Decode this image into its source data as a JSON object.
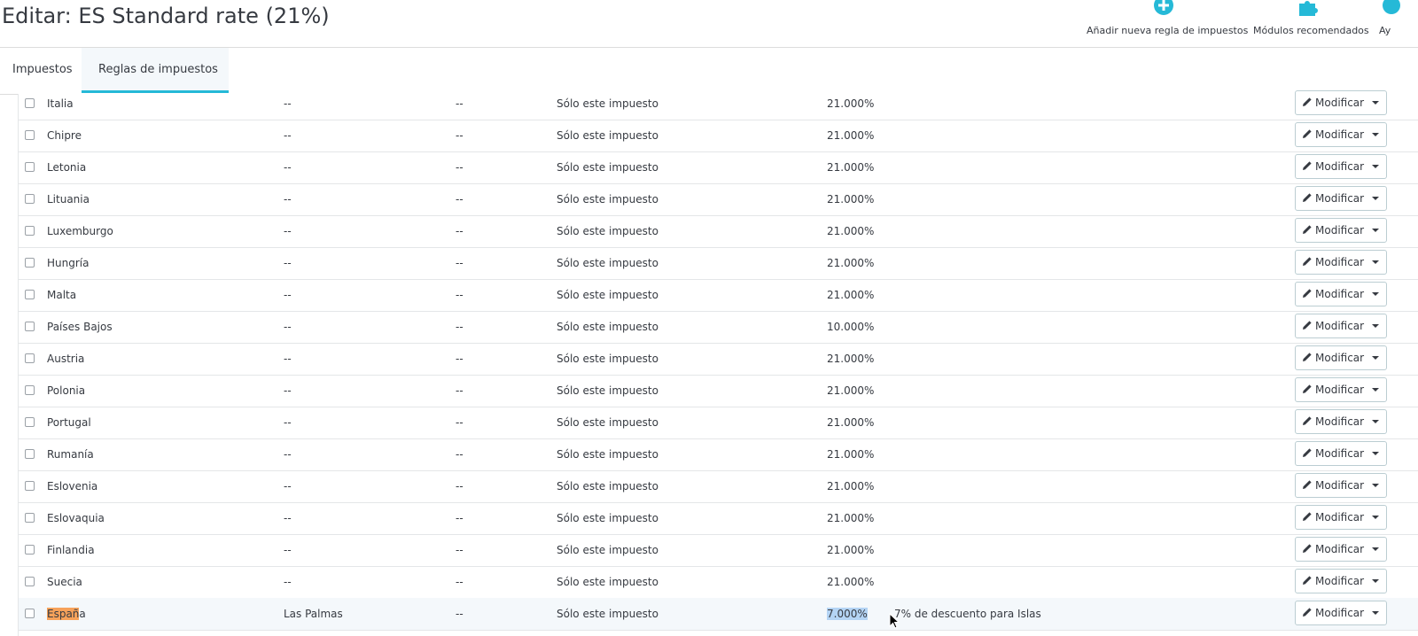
{
  "header": {
    "title": "Editar: ES Standard rate (21%)",
    "buttons": [
      {
        "label": "Añadir nueva regla de impuestos",
        "icon": "plus-circle-icon"
      },
      {
        "label": "Módulos recomendados",
        "icon": "puzzle-icon"
      },
      {
        "label": "Ay",
        "icon": "help-icon"
      }
    ]
  },
  "tabs": [
    {
      "label": "Impuestos",
      "active": false
    },
    {
      "label": "Reglas de impuestos",
      "active": true
    }
  ],
  "colors": {
    "accent": "#25b9d7",
    "highlight_row": "#f4f8fb",
    "search_match": "#f7a25a",
    "text_selection": "#b4d4f4"
  },
  "rules": [
    {
      "country": "Italia",
      "zip": "--",
      "b": "--",
      "behavior": "Sólo este impuesto",
      "rate": "21.000%",
      "description": "",
      "action": "Modificar"
    },
    {
      "country": "Chipre",
      "zip": "--",
      "b": "--",
      "behavior": "Sólo este impuesto",
      "rate": "21.000%",
      "description": "",
      "action": "Modificar"
    },
    {
      "country": "Letonia",
      "zip": "--",
      "b": "--",
      "behavior": "Sólo este impuesto",
      "rate": "21.000%",
      "description": "",
      "action": "Modificar"
    },
    {
      "country": "Lituania",
      "zip": "--",
      "b": "--",
      "behavior": "Sólo este impuesto",
      "rate": "21.000%",
      "description": "",
      "action": "Modificar"
    },
    {
      "country": "Luxemburgo",
      "zip": "--",
      "b": "--",
      "behavior": "Sólo este impuesto",
      "rate": "21.000%",
      "description": "",
      "action": "Modificar"
    },
    {
      "country": "Hungría",
      "zip": "--",
      "b": "--",
      "behavior": "Sólo este impuesto",
      "rate": "21.000%",
      "description": "",
      "action": "Modificar"
    },
    {
      "country": "Malta",
      "zip": "--",
      "b": "--",
      "behavior": "Sólo este impuesto",
      "rate": "21.000%",
      "description": "",
      "action": "Modificar"
    },
    {
      "country": "Países Bajos",
      "zip": "--",
      "b": "--",
      "behavior": "Sólo este impuesto",
      "rate": "10.000%",
      "description": "",
      "action": "Modificar"
    },
    {
      "country": "Austria",
      "zip": "--",
      "b": "--",
      "behavior": "Sólo este impuesto",
      "rate": "21.000%",
      "description": "",
      "action": "Modificar"
    },
    {
      "country": "Polonia",
      "zip": "--",
      "b": "--",
      "behavior": "Sólo este impuesto",
      "rate": "21.000%",
      "description": "",
      "action": "Modificar"
    },
    {
      "country": "Portugal",
      "zip": "--",
      "b": "--",
      "behavior": "Sólo este impuesto",
      "rate": "21.000%",
      "description": "",
      "action": "Modificar"
    },
    {
      "country": "Rumanía",
      "zip": "--",
      "b": "--",
      "behavior": "Sólo este impuesto",
      "rate": "21.000%",
      "description": "",
      "action": "Modificar"
    },
    {
      "country": "Eslovenia",
      "zip": "--",
      "b": "--",
      "behavior": "Sólo este impuesto",
      "rate": "21.000%",
      "description": "",
      "action": "Modificar"
    },
    {
      "country": "Eslovaquia",
      "zip": "--",
      "b": "--",
      "behavior": "Sólo este impuesto",
      "rate": "21.000%",
      "description": "",
      "action": "Modificar"
    },
    {
      "country": "Finlandia",
      "zip": "--",
      "b": "--",
      "behavior": "Sólo este impuesto",
      "rate": "21.000%",
      "description": "",
      "action": "Modificar"
    },
    {
      "country": "Suecia",
      "zip": "--",
      "b": "--",
      "behavior": "Sólo este impuesto",
      "rate": "21.000%",
      "description": "",
      "action": "Modificar"
    },
    {
      "country": "España",
      "country_match": "Españ",
      "country_rest": "a",
      "zip": "Las Palmas",
      "b": "--",
      "behavior": "Sólo este impuesto",
      "rate": "7.000%",
      "description": "7% de descuento para Islas",
      "action": "Modificar",
      "highlighted": true
    }
  ]
}
